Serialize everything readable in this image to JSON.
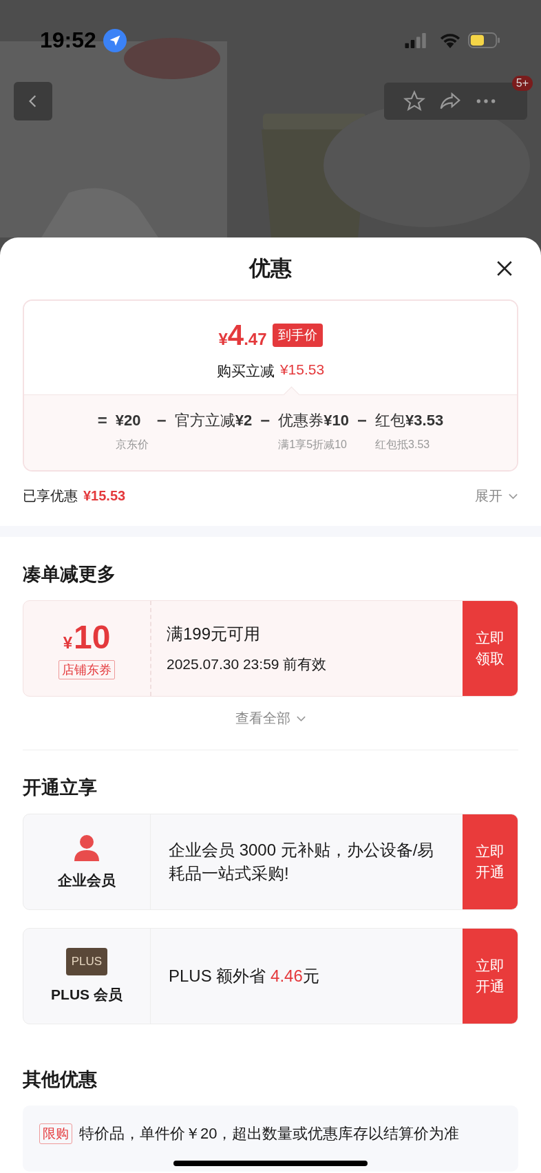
{
  "status_bar": {
    "time": "19:52"
  },
  "nav": {
    "badge": "5+"
  },
  "sheet": {
    "title": "优惠"
  },
  "price_card": {
    "currency": "¥",
    "integer": "4",
    "decimal": ".47",
    "tag": "到手价",
    "saving_label": "购买立减",
    "saving_value": "¥15.53",
    "terms": [
      {
        "operator": "=",
        "value": "¥20",
        "note": "京东价"
      },
      {
        "operator": "−",
        "label": "官方立减",
        "value": "¥2"
      },
      {
        "operator": "−",
        "label": "优惠券",
        "value": "¥10",
        "note": "满1享5折减10"
      },
      {
        "operator": "−",
        "label": "红包",
        "value": "¥3.53",
        "note": "红包抵3.53"
      }
    ]
  },
  "enjoyed": {
    "label": "已享优惠",
    "value": "¥15.53",
    "expand": "展开"
  },
  "coupon_section": {
    "title": "凑单减更多",
    "coupons": [
      {
        "currency": "¥",
        "amount": "10",
        "type": "店铺东券",
        "condition": "满199元可用",
        "validity": "2025.07.30 23:59 前有效",
        "action": "立即领取"
      }
    ],
    "see_all": "查看全部"
  },
  "member_section": {
    "title": "开通立享",
    "memberships": [
      {
        "kind": "person",
        "name": "企业会员",
        "description": "企业会员 3000 元补贴，办公设备/易耗品一站式采购!",
        "action": "立即开通"
      },
      {
        "kind": "plus",
        "logo": "PLUS",
        "name": "PLUS 会员",
        "description": "PLUS 额外省 ",
        "highlight": "4.46",
        "suffix": "元",
        "action": "立即开通"
      }
    ]
  },
  "other_section": {
    "title": "其他优惠",
    "offers": [
      {
        "tag": "限购",
        "text": "特价品，单件价￥20，超出数量或优惠库存以结算价为准"
      }
    ]
  }
}
